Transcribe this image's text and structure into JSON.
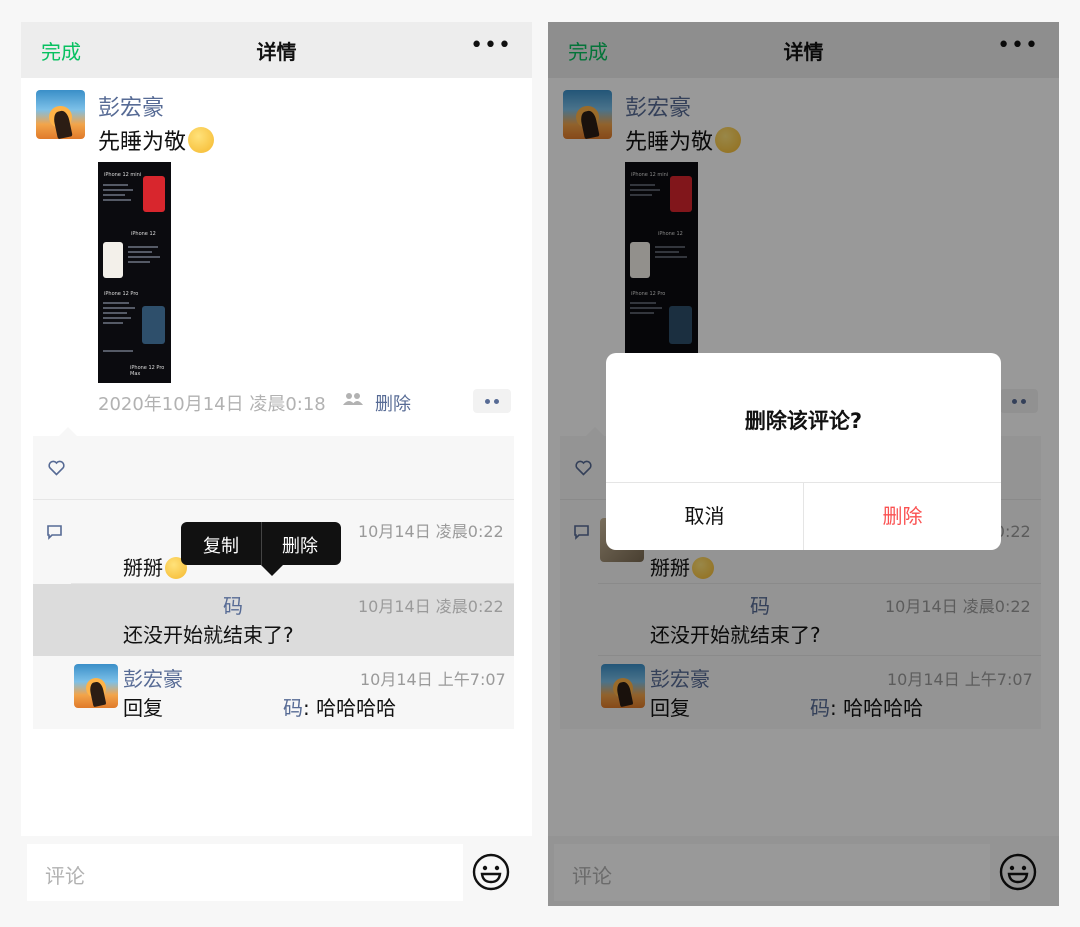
{
  "navbar": {
    "done": "完成",
    "title": "详情",
    "more": "•••"
  },
  "post": {
    "author": "彭宏豪",
    "text": "先睡为敬",
    "time": "2020年10月14日 凌晨0:18",
    "delete": "删除",
    "image_captions": [
      "iPhone 12 mini",
      "iPhone 12",
      "iPhone 12 Pro",
      "iPhone 12 Pro Max"
    ]
  },
  "comments": [
    {
      "name": "",
      "time": "10月14日 凌晨0:22",
      "text": "掰掰"
    },
    {
      "name": "码",
      "time": "10月14日 凌晨0:22",
      "text": "还没开始就结束了?"
    },
    {
      "name": "彭宏豪",
      "time": "10月14日 上午7:07",
      "text_prefix": "回复",
      "reply_to": "码",
      "text": ": 哈哈哈哈"
    }
  ],
  "context_menu": {
    "copy": "复制",
    "delete": "删除"
  },
  "input": {
    "placeholder": "评论"
  },
  "dialog": {
    "title": "删除该评论?",
    "cancel": "取消",
    "confirm": "删除"
  },
  "colors": {
    "accent_green": "#07c160",
    "link_blue": "#576b95",
    "danger_red": "#fa5151"
  }
}
